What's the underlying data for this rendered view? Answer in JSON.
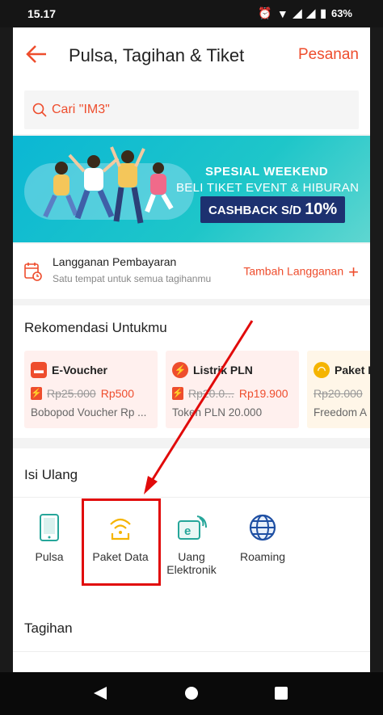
{
  "status_bar": {
    "time": "15.17",
    "battery": "63%"
  },
  "header": {
    "title": "Pulsa, Tagihan & Tiket",
    "orders_label": "Pesanan"
  },
  "search": {
    "placeholder": "Cari \"IM3\""
  },
  "banner": {
    "line1": "SPESIAL WEEKEND",
    "line2": "BELI TIKET EVENT & HIBURAN",
    "cashback_prefix": "CASHBACK S/D",
    "cashback_value": "10%"
  },
  "subscription": {
    "title": "Langganan Pembayaran",
    "subtitle": "Satu tempat untuk semua tagihanmu",
    "add_label": "Tambah Langganan"
  },
  "recommendations": {
    "title": "Rekomendasi Untukmu",
    "cards": [
      {
        "name": "E-Voucher",
        "old_price": "Rp25.000",
        "new_price": "Rp500",
        "desc": "Bobopod Voucher Rp ...",
        "icon": "voucher-icon"
      },
      {
        "name": "Listrik PLN",
        "old_price": "Rp20.0...",
        "new_price": "Rp19.900",
        "desc": "Token PLN 20.000",
        "icon": "electricity-icon"
      },
      {
        "name": "Paket D",
        "old_price": "Rp20.000",
        "new_price": "",
        "desc": "Freedom A",
        "icon": "wifi-icon"
      }
    ]
  },
  "top_up": {
    "title": "Isi Ulang",
    "items": [
      {
        "label": "Pulsa",
        "icon": "phone-icon"
      },
      {
        "label": "Paket Data",
        "icon": "wifi-icon"
      },
      {
        "label": "Uang Elektronik",
        "icon": "e-money-icon"
      },
      {
        "label": "Roaming",
        "icon": "globe-icon"
      }
    ]
  },
  "bills": {
    "title": "Tagihan"
  },
  "colors": {
    "accent": "#ee4d2d",
    "highlight": "#e10a0a",
    "teal": "#26a69a"
  }
}
